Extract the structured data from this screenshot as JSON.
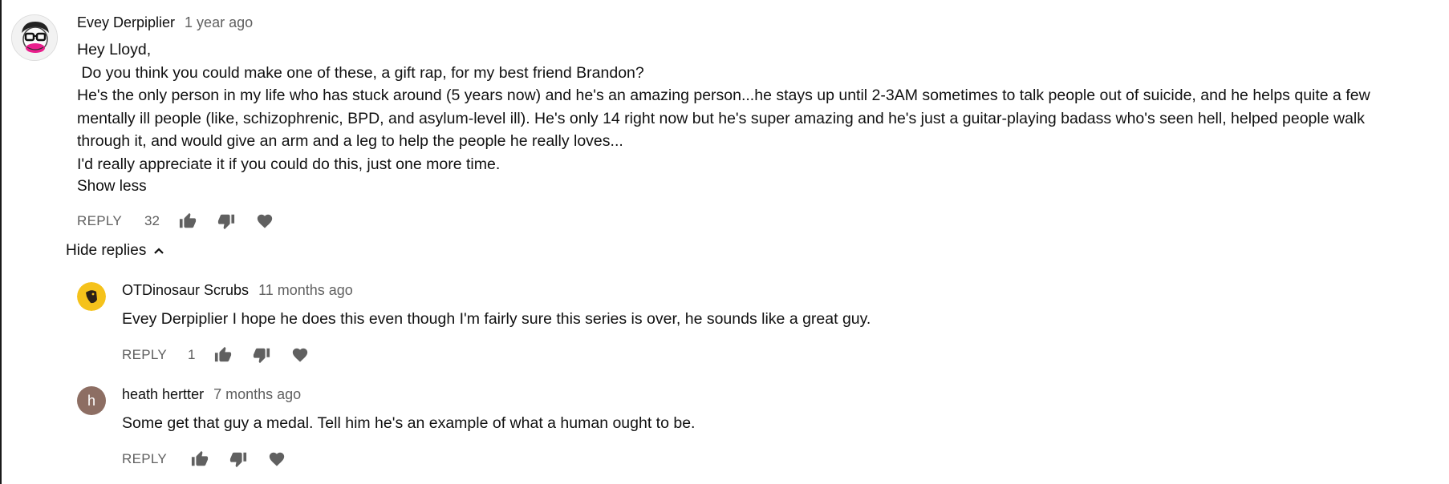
{
  "main_comment": {
    "author": "Evey Derpiplier",
    "time": "1 year ago",
    "lines": [
      "Hey Lloyd,",
      " Do you think you could make one of these, a gift rap, for my best friend Brandon?",
      "He's the only person in my life who has stuck around (5 years now) and he's an amazing person...he stays up until 2-3AM sometimes to talk people out of suicide, and he helps quite a few",
      "mentally ill people (like, schizophrenic, BPD, and asylum-level ill). He's only 14 right now but he's super amazing and he's just a guitar-playing badass who's seen hell, helped people walk",
      "through it, and would give an arm and a leg to help the people he really loves...",
      "I'd really appreciate it if you could do this, just one more time."
    ],
    "show_less": "Show less",
    "reply_label": "REPLY",
    "like_count": "32"
  },
  "hide_replies_label": "Hide replies",
  "replies": [
    {
      "author": "OTDinosaur Scrubs",
      "time": "11 months ago",
      "text": "Evey Derpiplier I hope he does this even though I'm fairly sure this series is over, he sounds like a great guy.",
      "reply_label": "REPLY",
      "like_count": "1",
      "avatar_color": "#f5c21b"
    },
    {
      "author": "heath hertter",
      "time": "7 months ago",
      "text": "Some get that guy a medal. Tell him he's an example of what a human ought to be.",
      "reply_label": "REPLY",
      "like_count": "",
      "avatar_letter": "h",
      "avatar_color": "#8d6e63"
    }
  ],
  "icons": {
    "like": "thumbs-up-icon",
    "dislike": "thumbs-down-icon",
    "heart": "heart-icon",
    "chevron": "chevron-up-icon"
  }
}
